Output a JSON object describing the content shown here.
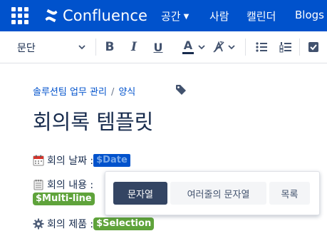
{
  "header": {
    "logo_text": "Confluence",
    "nav": [
      {
        "label": "공간"
      },
      {
        "label": "사람"
      },
      {
        "label": "캘린더"
      },
      {
        "label": "Blogs"
      }
    ]
  },
  "toolbar": {
    "paragraph_label": "문단",
    "bold": "B",
    "italic": "I",
    "underline": "U",
    "text_color": "A"
  },
  "breadcrumb": [
    {
      "label": "솔루션팀 업무 관리"
    },
    {
      "label": "양식"
    }
  ],
  "breadcrumb_separator": "/",
  "page": {
    "title": "회의록 템플릿",
    "fields": [
      {
        "label": "회의 날짜 : ",
        "variable": "$Date",
        "icon": "calendar-icon"
      },
      {
        "label": "회의 내용 : ",
        "variable": "$Multi-line",
        "icon": "notepad-icon"
      },
      {
        "label": "회의 제품 : ",
        "variable": "$Selection",
        "icon": "gear-icon"
      }
    ]
  },
  "popup": {
    "options": [
      {
        "label": "문자열",
        "active": true
      },
      {
        "label": "여러줄의 문자열",
        "active": false
      },
      {
        "label": "목록",
        "active": false
      }
    ]
  },
  "colors": {
    "brand": "#0052cc",
    "variable_green": "#5fa33b",
    "active_option": "#344563"
  }
}
